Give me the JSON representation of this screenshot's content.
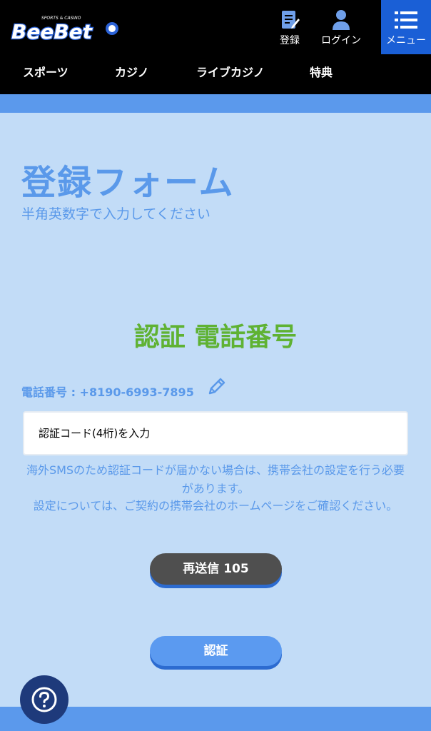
{
  "header": {
    "logo_text": "BeeBet",
    "logo_tagline": "SPORTS & CASINO",
    "register_label": "登録",
    "login_label": "ログイン",
    "menu_label": "メニュー",
    "icons": {
      "register": "register-icon",
      "login": "user-icon",
      "menu": "menu-icon"
    }
  },
  "nav": {
    "items": [
      "スポーツ",
      "カジノ",
      "ライブカジノ",
      "特典"
    ]
  },
  "form": {
    "title": "登録フォーム",
    "subtitle": "半角英数字で入力してください",
    "verify_title": "認証 電話番号",
    "phone_line": "電話番号 : +8190-6993-7895",
    "code_placeholder": "認証コード(4桁)を入力",
    "note1": "海外SMSのため認証コードが届かない場合は、携帯会社の設定を行う必要があります。",
    "note2": "設定については、ご契約の携帯会社のホームページをご確認ください。",
    "resend_label": "再送信 105",
    "verify_button": "認証"
  },
  "help": {
    "icon": "question-icon"
  },
  "colors": {
    "background": "#c2dcf7",
    "band": "#5b99ec",
    "accent_text": "#5a99ea",
    "verify_green": "#5fb233",
    "header_bg": "#000000",
    "menu_bg": "#1a5fd6",
    "resend_bg": "#4f4f4f",
    "verify_bg": "#5b9af0",
    "help_bg": "#1e3a7b"
  }
}
